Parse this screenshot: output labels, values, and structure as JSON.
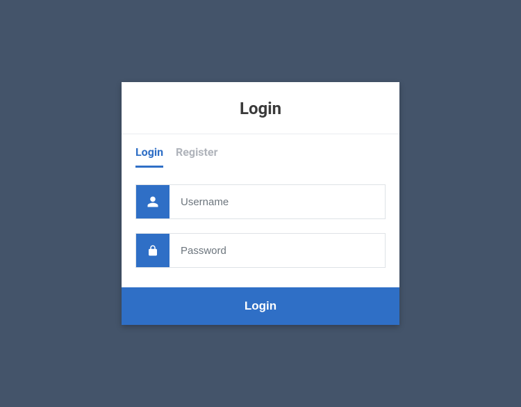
{
  "header": {
    "title": "Login"
  },
  "tabs": {
    "login": "Login",
    "register": "Register"
  },
  "form": {
    "username_placeholder": "Username",
    "password_placeholder": "Password"
  },
  "submit": {
    "label": "Login"
  },
  "colors": {
    "primary": "#2f6fc6",
    "background": "#44546a"
  }
}
